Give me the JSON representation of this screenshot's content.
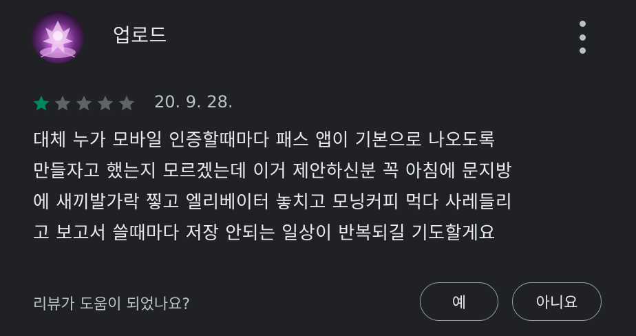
{
  "reviewer": {
    "name": "업로드",
    "avatar_icon": "pink-fantasy-creature-avatar"
  },
  "menu_icon": "more-vert-icon",
  "rating": {
    "value": 1,
    "max": 5,
    "filled_color": "#01875f",
    "empty_color": "#5f6368"
  },
  "date": "20. 9. 28.",
  "review_lines": [
    "대체 누가 모바일 인증할때마다 패스 앱이 기본으로 나오도록",
    "만들자고 했는지 모르겠는데 이거 제안하신분 꼭 아침에 문지방",
    "에 새끼발가락 찧고 엘리베이터 놓치고 모닝커피 먹다 사레들리",
    "고 보고서 쓸때마다 저장 안되는 일상이 반복되길 기도할게요"
  ],
  "helpful": {
    "question": "리뷰가 도움이 되었나요?",
    "yes_label": "예",
    "no_label": "아니요"
  }
}
